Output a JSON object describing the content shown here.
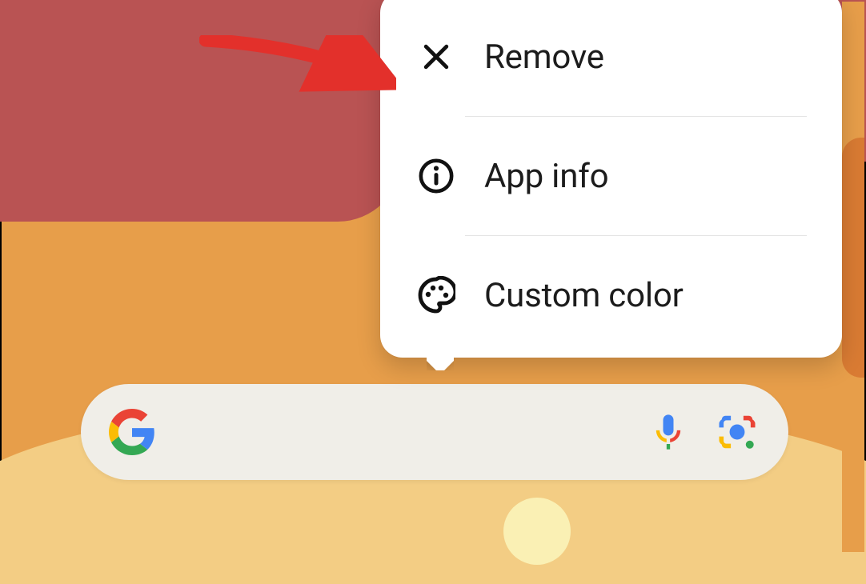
{
  "menu": {
    "items": [
      {
        "label": "Remove"
      },
      {
        "label": "App info"
      },
      {
        "label": "Custom color"
      }
    ]
  },
  "annotation": {
    "target": "remove-menu-item"
  }
}
